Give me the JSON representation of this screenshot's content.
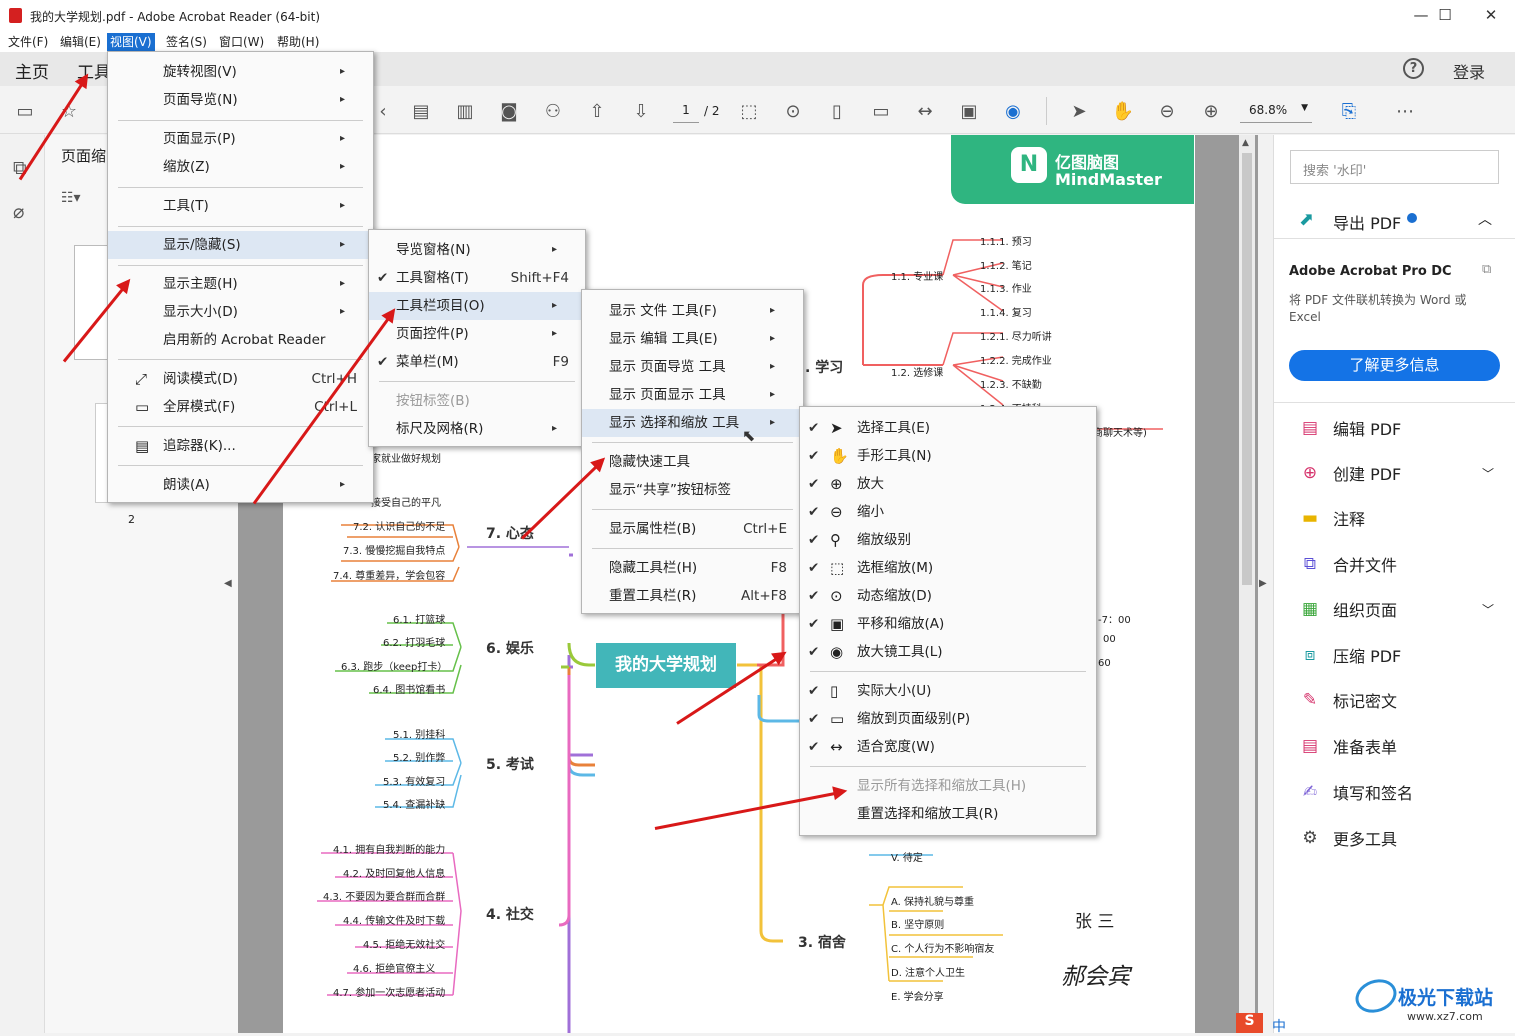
{
  "window": {
    "title": "我的大学规划.pdf - Adobe Acrobat Reader (64-bit)",
    "min": "—",
    "max": "☐",
    "close": "✕"
  },
  "menubar": [
    "文件(F)",
    "编辑(E)",
    "视图(V)",
    "签名(S)",
    "窗口(W)",
    "帮助(H)"
  ],
  "nav": {
    "home": "主页",
    "tools": "工具",
    "login": "登录",
    "help": "?"
  },
  "toolbar": {
    "page_current": "1",
    "page_total": "/ 2",
    "zoom": "68.8%"
  },
  "left_panel": {
    "title": "页面缩",
    "page_num": "2"
  },
  "menu_view": {
    "items": [
      {
        "label": "旋转视图(V)",
        "arrow": "▸"
      },
      {
        "label": "页面导览(N)",
        "arrow": "▸"
      },
      {
        "label": "页面显示(P)",
        "arrow": "▸"
      },
      {
        "label": "缩放(Z)",
        "arrow": "▸"
      },
      {
        "label": "工具(T)",
        "arrow": "▸"
      },
      {
        "label": "显示/隐藏(S)",
        "arrow": "▸"
      },
      {
        "label": "显示主题(H)",
        "arrow": "▸"
      },
      {
        "label": "显示大小(D)",
        "arrow": "▸"
      },
      {
        "label": "启用新的 Acrobat Reader"
      },
      {
        "label": "阅读模式(D)",
        "shortcut": "Ctrl+H"
      },
      {
        "label": "全屏模式(F)",
        "shortcut": "Ctrl+L"
      },
      {
        "label": "追踪器(K)..."
      },
      {
        "label": "朗读(A)",
        "arrow": "▸"
      }
    ]
  },
  "menu_showhide": {
    "items": [
      {
        "label": "导览窗格(N)",
        "arrow": "▸"
      },
      {
        "label": "工具窗格(T)",
        "shortcut": "Shift+F4",
        "check": "✔"
      },
      {
        "label": "工具栏项目(O)",
        "arrow": "▸"
      },
      {
        "label": "页面控件(P)",
        "arrow": "▸"
      },
      {
        "label": "菜单栏(M)",
        "shortcut": "F9",
        "check": "✔"
      },
      {
        "label": "按钮标签(B)"
      },
      {
        "label": "标尺及网格(R)",
        "arrow": "▸"
      }
    ]
  },
  "menu_toolbar_items": {
    "items": [
      {
        "label": "显示 文件 工具(F)",
        "arrow": "▸"
      },
      {
        "label": "显示 编辑 工具(E)",
        "arrow": "▸"
      },
      {
        "label": "显示 页面导览 工具",
        "arrow": "▸"
      },
      {
        "label": "显示 页面显示 工具",
        "arrow": "▸"
      },
      {
        "label": "显示 选择和缩放 工具",
        "arrow": "▸"
      },
      {
        "label": "隐藏快速工具"
      },
      {
        "label": "显示“共享”按钮标签"
      },
      {
        "label": "显示属性栏(B)",
        "shortcut": "Ctrl+E"
      },
      {
        "label": "隐藏工具栏(H)",
        "shortcut": "F8"
      },
      {
        "label": "重置工具栏(R)",
        "shortcut": "Alt+F8"
      }
    ]
  },
  "menu_select_zoom": {
    "items": [
      {
        "label": "选择工具(E)",
        "icon": "cursor-icon",
        "glyph": "➤"
      },
      {
        "label": "手形工具(N)",
        "icon": "hand-icon",
        "glyph": "✋"
      },
      {
        "label": "放大",
        "icon": "zoom-in-icon",
        "glyph": "⊕"
      },
      {
        "label": "缩小",
        "icon": "zoom-out-icon",
        "glyph": "⊖"
      },
      {
        "label": "缩放级别",
        "icon": "zoom-level-icon",
        "glyph": "⚲"
      },
      {
        "label": "选框缩放(M)",
        "icon": "marquee-zoom-icon",
        "glyph": "⬚"
      },
      {
        "label": "动态缩放(D)",
        "icon": "dynamic-zoom-icon",
        "glyph": "⊙"
      },
      {
        "label": "平移和缩放(A)",
        "icon": "pan-zoom-icon",
        "glyph": "▣"
      },
      {
        "label": "放大镜工具(L)",
        "icon": "loupe-icon",
        "glyph": "◉"
      },
      {
        "label": "实际大小(U)",
        "icon": "actual-size-icon",
        "glyph": "▯"
      },
      {
        "label": "缩放到页面级别(P)",
        "icon": "fit-page-icon",
        "glyph": "▭"
      },
      {
        "label": "适合宽度(W)",
        "icon": "fit-width-icon",
        "glyph": "↔"
      },
      {
        "label": "显示所有选择和缩放工具(H)"
      },
      {
        "label": "重置选择和缩放工具(R)"
      }
    ],
    "check": "✔"
  },
  "right_panel": {
    "search_placeholder": "搜索 '水印'",
    "export": "导出 PDF",
    "promo_title": "Adobe Acrobat Pro DC",
    "promo_text": "将 PDF 文件联机转换为 Word 或 Excel",
    "promo_button": "了解更多信息",
    "tools": [
      {
        "label": "编辑 PDF",
        "icon": "edit-pdf-icon",
        "color": "#d6336c"
      },
      {
        "label": "创建 PDF",
        "icon": "create-pdf-icon",
        "color": "#d6336c"
      },
      {
        "label": "注释",
        "icon": "comment-icon",
        "color": "#e8b400"
      },
      {
        "label": "合并文件",
        "icon": "combine-icon",
        "color": "#5b4fd6"
      },
      {
        "label": "组织页面",
        "icon": "organize-icon",
        "color": "#3aa63a"
      },
      {
        "label": "压缩 PDF",
        "icon": "compress-icon",
        "color": "#1a9aa0"
      },
      {
        "label": "标记密文",
        "icon": "redact-icon",
        "color": "#d6336c"
      },
      {
        "label": "准备表单",
        "icon": "form-icon",
        "color": "#d6336c"
      },
      {
        "label": "填写和签名",
        "icon": "sign-icon",
        "color": "#7b61d6"
      },
      {
        "label": "更多工具",
        "icon": "more-tools-icon",
        "color": "#444"
      }
    ]
  },
  "doc": {
    "brand_cn": "亿图脑图",
    "brand_en": "MindMaster",
    "center": "我的大学规划",
    "branches": {
      "study": ". 学习",
      "mind": "7. 心态",
      "fun": "6. 娱乐",
      "exam": "5. 考试",
      "social": "4. 社交",
      "dorm": "3. 宿舍"
    },
    "study_nodes": [
      "1.1. 专业课",
      "1.2. 选修课",
      "1.1.1. 预习",
      "1.1.2. 笔记",
      "1.1.3. 作业",
      "1.1.4. 复习",
      "1.2.1. 尽力听讲",
      "1.2.2. 完成作业",
      "1.2.3. 不缺勤",
      "1.2.4. 不挂科",
      "商聊天术等)"
    ],
    "mind_nodes": [
      "家就业做好规划",
      "接受自己的平凡",
      "7.2. 认识自己的不足",
      "7.3. 慢慢挖掘自我特点",
      "7.4. 尊重差异，学会包容"
    ],
    "fun_nodes": [
      "6.1. 打篮球",
      "6.2. 打羽毛球",
      "6.3. 跑步（keep打卡）",
      "6.4. 图书馆看书"
    ],
    "exam_nodes": [
      "5.1. 别挂科",
      "5.2. 别作弊",
      "5.3. 有效复习",
      "5.4. 查漏补缺"
    ],
    "social_nodes": [
      "4.1. 拥有自我判断的能力",
      "4.2. 及时回复他人信息",
      "4.3. 不要因为要合群而合群",
      "4.4. 传输文件及时下载",
      "4.5. 拒绝无效社交",
      "4.6. 拒绝官僚主义",
      "4.7. 参加一次志愿者活动"
    ],
    "dorm_nodes": [
      "A. 保持礼貌与尊重",
      "B. 坚守原则",
      "C. 个人行为不影响宿友",
      "D. 注意个人卫生",
      "E. 学会分享"
    ],
    "misc": [
      "-7：00",
      "00",
      "60",
      "V. 待定"
    ],
    "signature_print": "张 三",
    "signature_hand": "郝会宾"
  },
  "watermark": "极光下载站",
  "watermark_url": "www.xz7.com",
  "ime": "中"
}
